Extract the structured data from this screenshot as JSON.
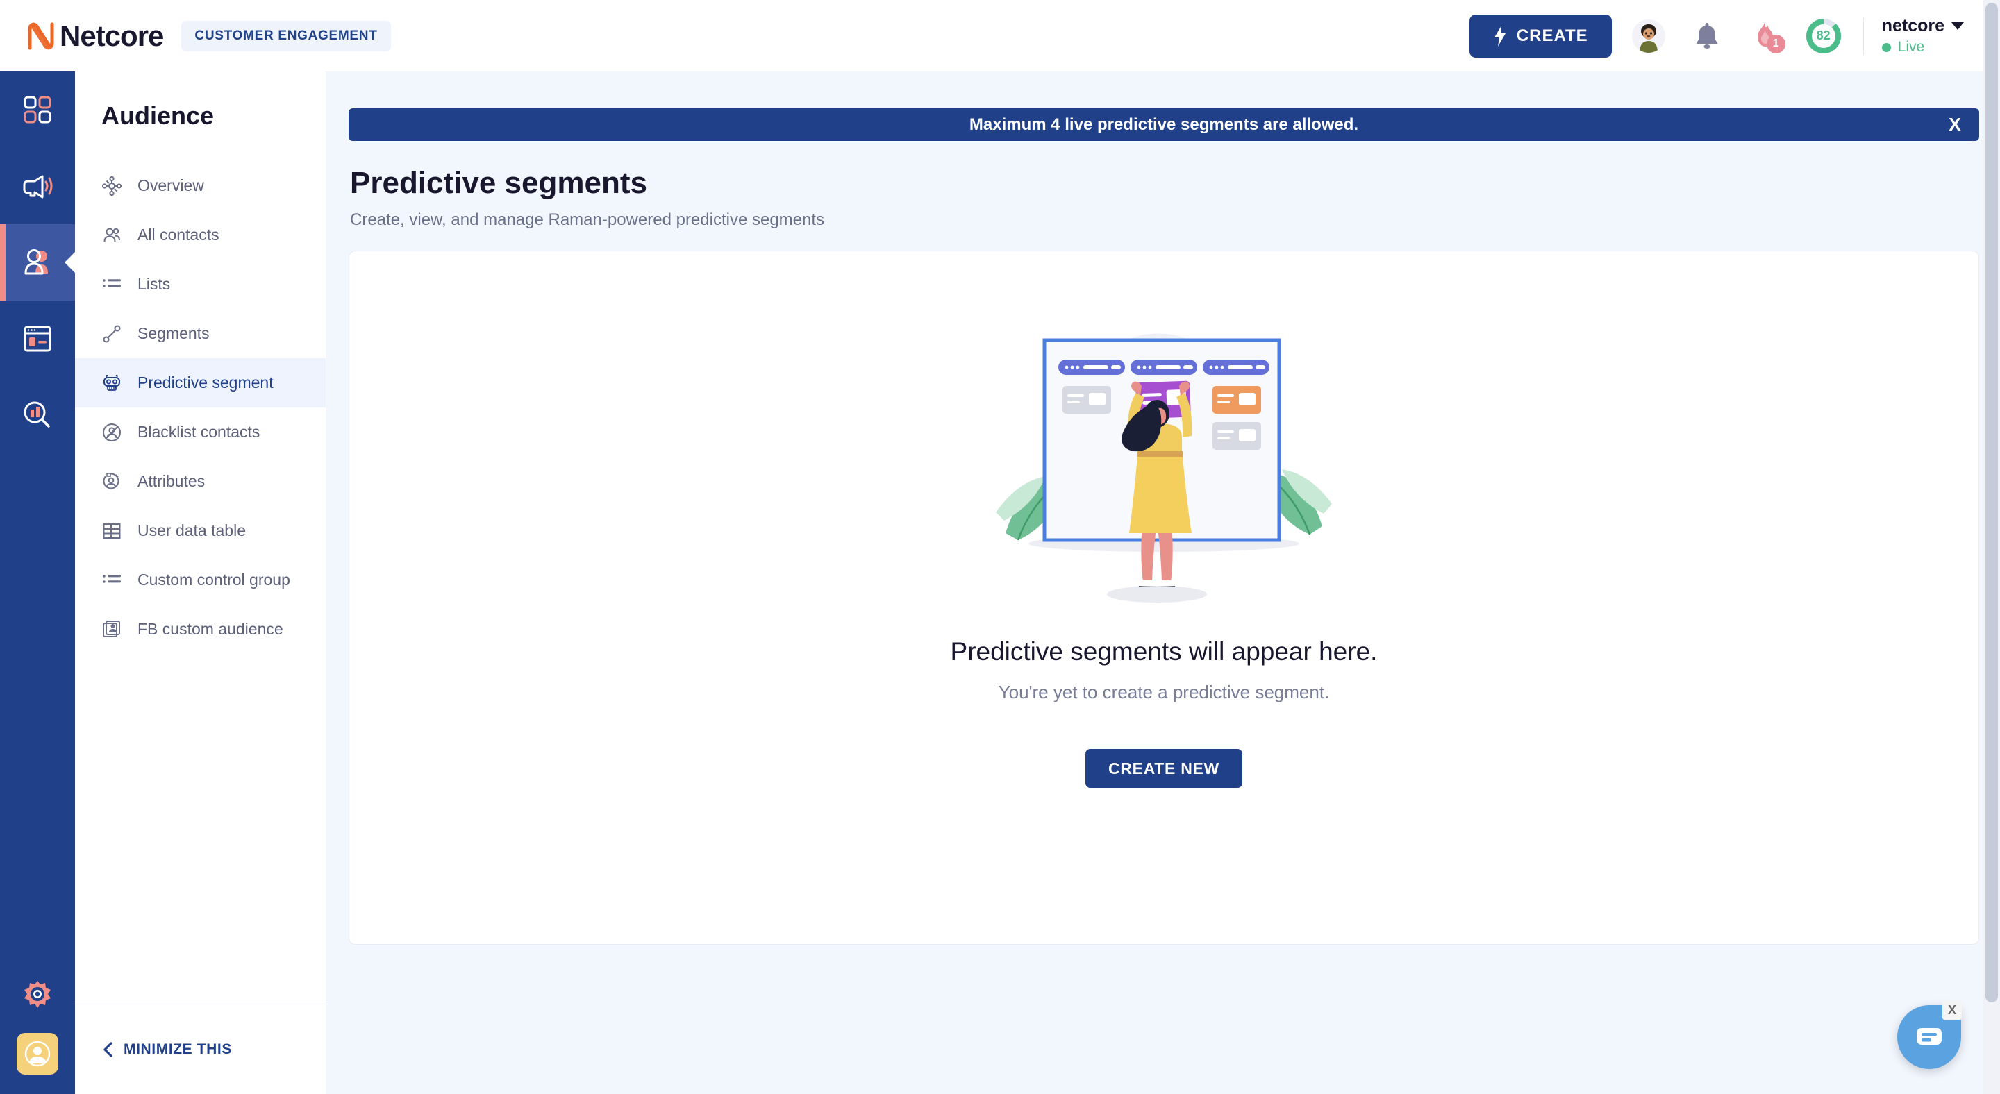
{
  "header": {
    "logo_text": "Netcore",
    "logo_icon": "netcore-logo-icon",
    "product_pill": "CUSTOMER ENGAGEMENT",
    "create_label": "CREATE",
    "create_icon": "bolt-icon",
    "avatar_icon": "user-avatar-icon",
    "bell_icon": "bell-icon",
    "flame_icon": "flame-icon",
    "flame_badge": "1",
    "health_score": "82",
    "account_name": "netcore",
    "account_status": "Live",
    "caret_icon": "chevron-down-icon",
    "accent_blue": "#21408a",
    "accent_green": "#4bbd8b",
    "accent_pink": "#e98b96"
  },
  "rail": {
    "items": [
      {
        "name": "dashboard",
        "icon": "grid-squares-icon",
        "active": false
      },
      {
        "name": "campaigns",
        "icon": "megaphone-icon",
        "active": false
      },
      {
        "name": "audience",
        "icon": "people-icon",
        "active": true
      },
      {
        "name": "channels",
        "icon": "browser-window-icon",
        "active": false
      },
      {
        "name": "analytics",
        "icon": "chart-search-icon",
        "active": false
      }
    ],
    "settings_icon": "gear-eye-icon",
    "profile_icon": "user-profile-icon"
  },
  "sidebar": {
    "title": "Audience",
    "items": [
      {
        "label": "Overview",
        "icon": "hub-nodes-icon",
        "active": false
      },
      {
        "label": "All contacts",
        "icon": "contacts-group-icon",
        "active": false
      },
      {
        "label": "Lists",
        "icon": "list-icon",
        "active": false
      },
      {
        "label": "Segments",
        "icon": "segments-node-icon",
        "active": false
      },
      {
        "label": "Predictive segment",
        "icon": "predictive-robot-icon",
        "active": true
      },
      {
        "label": "Blacklist contacts",
        "icon": "blocked-user-icon",
        "active": false
      },
      {
        "label": "Attributes",
        "icon": "attributes-user-icon",
        "active": false
      },
      {
        "label": "User data table",
        "icon": "table-grid-icon",
        "active": false
      },
      {
        "label": "Custom control group",
        "icon": "list-icon",
        "active": false
      },
      {
        "label": "FB custom audience",
        "icon": "stacked-user-card-icon",
        "active": false
      }
    ],
    "minimize_label": "MINIMIZE THIS",
    "minimize_icon": "chevron-left-icon"
  },
  "main": {
    "banner_text": "Maximum 4 live predictive segments are allowed.",
    "banner_close_icon": "close-icon",
    "page_title": "Predictive segments",
    "page_subtitle": "Create, view, and manage Raman-powered predictive segments",
    "illustration_name": "woman-organizing-cards-illustration",
    "empty_title": "Predictive segments will appear here.",
    "empty_subtitle": "You're yet to create a predictive segment.",
    "create_new_label": "CREATE NEW"
  },
  "chat": {
    "icon": "chat-message-icon",
    "close_label": "X"
  }
}
